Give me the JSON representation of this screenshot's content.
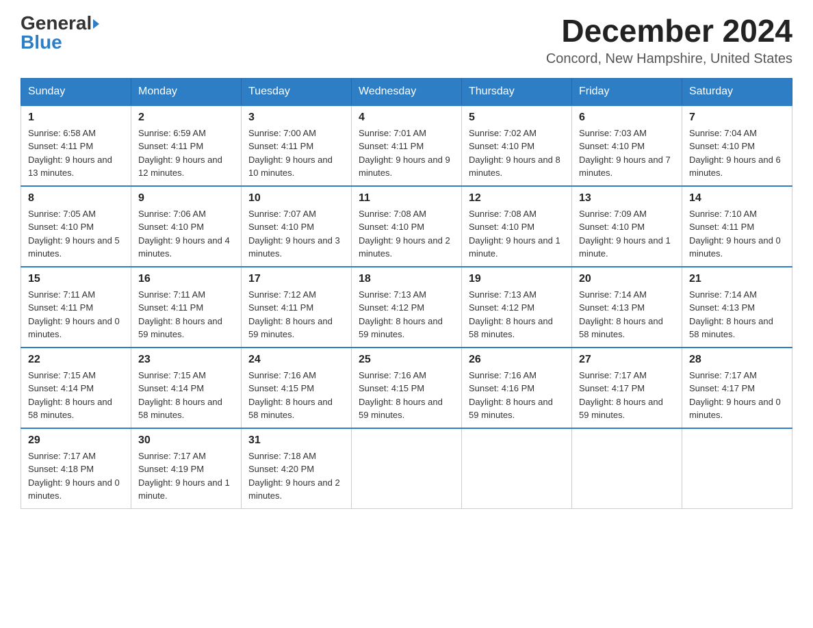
{
  "logo": {
    "general": "General",
    "blue": "Blue"
  },
  "header": {
    "month_year": "December 2024",
    "location": "Concord, New Hampshire, United States"
  },
  "days_of_week": [
    "Sunday",
    "Monday",
    "Tuesday",
    "Wednesday",
    "Thursday",
    "Friday",
    "Saturday"
  ],
  "weeks": [
    [
      {
        "day": "1",
        "sunrise": "6:58 AM",
        "sunset": "4:11 PM",
        "daylight": "9 hours and 13 minutes."
      },
      {
        "day": "2",
        "sunrise": "6:59 AM",
        "sunset": "4:11 PM",
        "daylight": "9 hours and 12 minutes."
      },
      {
        "day": "3",
        "sunrise": "7:00 AM",
        "sunset": "4:11 PM",
        "daylight": "9 hours and 10 minutes."
      },
      {
        "day": "4",
        "sunrise": "7:01 AM",
        "sunset": "4:11 PM",
        "daylight": "9 hours and 9 minutes."
      },
      {
        "day": "5",
        "sunrise": "7:02 AM",
        "sunset": "4:10 PM",
        "daylight": "9 hours and 8 minutes."
      },
      {
        "day": "6",
        "sunrise": "7:03 AM",
        "sunset": "4:10 PM",
        "daylight": "9 hours and 7 minutes."
      },
      {
        "day": "7",
        "sunrise": "7:04 AM",
        "sunset": "4:10 PM",
        "daylight": "9 hours and 6 minutes."
      }
    ],
    [
      {
        "day": "8",
        "sunrise": "7:05 AM",
        "sunset": "4:10 PM",
        "daylight": "9 hours and 5 minutes."
      },
      {
        "day": "9",
        "sunrise": "7:06 AM",
        "sunset": "4:10 PM",
        "daylight": "9 hours and 4 minutes."
      },
      {
        "day": "10",
        "sunrise": "7:07 AM",
        "sunset": "4:10 PM",
        "daylight": "9 hours and 3 minutes."
      },
      {
        "day": "11",
        "sunrise": "7:08 AM",
        "sunset": "4:10 PM",
        "daylight": "9 hours and 2 minutes."
      },
      {
        "day": "12",
        "sunrise": "7:08 AM",
        "sunset": "4:10 PM",
        "daylight": "9 hours and 1 minute."
      },
      {
        "day": "13",
        "sunrise": "7:09 AM",
        "sunset": "4:10 PM",
        "daylight": "9 hours and 1 minute."
      },
      {
        "day": "14",
        "sunrise": "7:10 AM",
        "sunset": "4:11 PM",
        "daylight": "9 hours and 0 minutes."
      }
    ],
    [
      {
        "day": "15",
        "sunrise": "7:11 AM",
        "sunset": "4:11 PM",
        "daylight": "9 hours and 0 minutes."
      },
      {
        "day": "16",
        "sunrise": "7:11 AM",
        "sunset": "4:11 PM",
        "daylight": "8 hours and 59 minutes."
      },
      {
        "day": "17",
        "sunrise": "7:12 AM",
        "sunset": "4:11 PM",
        "daylight": "8 hours and 59 minutes."
      },
      {
        "day": "18",
        "sunrise": "7:13 AM",
        "sunset": "4:12 PM",
        "daylight": "8 hours and 59 minutes."
      },
      {
        "day": "19",
        "sunrise": "7:13 AM",
        "sunset": "4:12 PM",
        "daylight": "8 hours and 58 minutes."
      },
      {
        "day": "20",
        "sunrise": "7:14 AM",
        "sunset": "4:13 PM",
        "daylight": "8 hours and 58 minutes."
      },
      {
        "day": "21",
        "sunrise": "7:14 AM",
        "sunset": "4:13 PM",
        "daylight": "8 hours and 58 minutes."
      }
    ],
    [
      {
        "day": "22",
        "sunrise": "7:15 AM",
        "sunset": "4:14 PM",
        "daylight": "8 hours and 58 minutes."
      },
      {
        "day": "23",
        "sunrise": "7:15 AM",
        "sunset": "4:14 PM",
        "daylight": "8 hours and 58 minutes."
      },
      {
        "day": "24",
        "sunrise": "7:16 AM",
        "sunset": "4:15 PM",
        "daylight": "8 hours and 58 minutes."
      },
      {
        "day": "25",
        "sunrise": "7:16 AM",
        "sunset": "4:15 PM",
        "daylight": "8 hours and 59 minutes."
      },
      {
        "day": "26",
        "sunrise": "7:16 AM",
        "sunset": "4:16 PM",
        "daylight": "8 hours and 59 minutes."
      },
      {
        "day": "27",
        "sunrise": "7:17 AM",
        "sunset": "4:17 PM",
        "daylight": "8 hours and 59 minutes."
      },
      {
        "day": "28",
        "sunrise": "7:17 AM",
        "sunset": "4:17 PM",
        "daylight": "9 hours and 0 minutes."
      }
    ],
    [
      {
        "day": "29",
        "sunrise": "7:17 AM",
        "sunset": "4:18 PM",
        "daylight": "9 hours and 0 minutes."
      },
      {
        "day": "30",
        "sunrise": "7:17 AM",
        "sunset": "4:19 PM",
        "daylight": "9 hours and 1 minute."
      },
      {
        "day": "31",
        "sunrise": "7:18 AM",
        "sunset": "4:20 PM",
        "daylight": "9 hours and 2 minutes."
      },
      null,
      null,
      null,
      null
    ]
  ]
}
